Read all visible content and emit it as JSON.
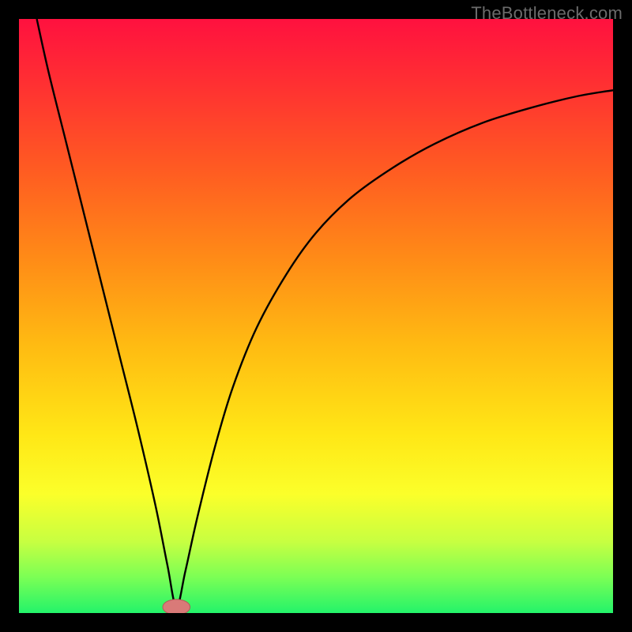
{
  "watermark": "TheBottleneck.com",
  "colors": {
    "gradient_stops": [
      {
        "offset": 0.0,
        "color": "#ff113f"
      },
      {
        "offset": 0.1,
        "color": "#ff2d33"
      },
      {
        "offset": 0.25,
        "color": "#ff5a22"
      },
      {
        "offset": 0.4,
        "color": "#ff8a17"
      },
      {
        "offset": 0.55,
        "color": "#ffbb12"
      },
      {
        "offset": 0.7,
        "color": "#ffe716"
      },
      {
        "offset": 0.8,
        "color": "#fbff2a"
      },
      {
        "offset": 0.88,
        "color": "#c7ff41"
      },
      {
        "offset": 0.94,
        "color": "#7bff55"
      },
      {
        "offset": 1.0,
        "color": "#23f36a"
      }
    ],
    "curve": "#000000",
    "marker_fill": "#d97a78",
    "marker_stroke": "#b45a58"
  },
  "chart_data": {
    "type": "line",
    "title": "",
    "xlabel": "",
    "ylabel": "",
    "xlim": [
      0,
      100
    ],
    "ylim": [
      0,
      100
    ],
    "minimum_at_x": 26.5,
    "series": [
      {
        "name": "curve",
        "x": [
          3,
          5,
          8,
          11,
          14,
          17,
          20,
          23,
          25,
          26.5,
          28,
          30,
          33,
          36,
          40,
          45,
          50,
          56,
          63,
          70,
          78,
          86,
          94,
          100
        ],
        "y": [
          100,
          91,
          79,
          67,
          55,
          43,
          31,
          18,
          8,
          1,
          7,
          16,
          28,
          38,
          48,
          57,
          64,
          70,
          75,
          79,
          82.5,
          85,
          87,
          88
        ]
      }
    ],
    "marker": {
      "x": 26.5,
      "y": 1,
      "rx": 2.3,
      "ry": 1.3
    }
  }
}
